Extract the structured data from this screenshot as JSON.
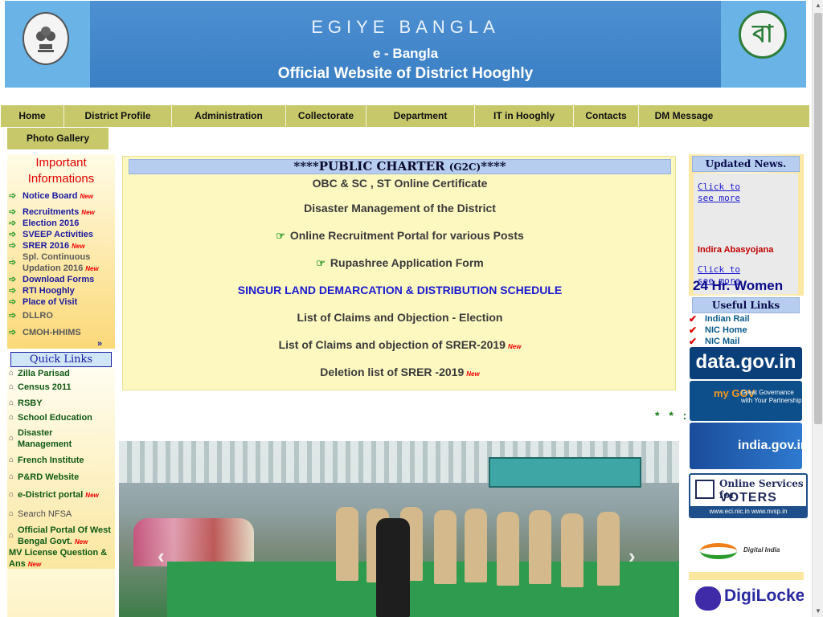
{
  "header": {
    "title_line1": "EGIYE BANGLA",
    "title_line2": "e - Bangla",
    "title_line3": "Official Website of District Hooghly",
    "right_logo_glyph": "বা"
  },
  "nav": {
    "items": [
      "Home",
      "District Profile",
      "Administration",
      "Collectorate",
      "Department",
      "IT in Hooghly",
      "Contacts",
      "DM Message"
    ],
    "row2": "Photo Gallery"
  },
  "important": {
    "title_line1": "Important",
    "title_line2": "Informations",
    "new_label": "New",
    "items": [
      {
        "label": "Notice Board",
        "is_new": true
      },
      {
        "label": "Recruitments",
        "is_new": true
      },
      {
        "label": "Election 2016",
        "is_new": false
      },
      {
        "label": "SVEEP Activities",
        "is_new": false
      },
      {
        "label": "SRER 2016",
        "is_new": true
      },
      {
        "label": "Spl. Continuous Updation 2016",
        "is_new": true
      },
      {
        "label": "Download Forms",
        "is_new": false
      },
      {
        "label": "RTI Hooghly",
        "is_new": false
      },
      {
        "label": "Place of Visit",
        "is_new": false
      },
      {
        "label": "DLLRO",
        "is_new": false
      },
      {
        "label": "CMOH-HHIMS",
        "is_new": false
      }
    ]
  },
  "quick_links": {
    "title": "Quick Links",
    "items": [
      {
        "label": "Zilla Parisad"
      },
      {
        "label": "Census 2011"
      },
      {
        "label": "RSBY"
      },
      {
        "label": "School Education"
      },
      {
        "label": "Disaster Management"
      },
      {
        "label": "French Institute"
      },
      {
        "label": "P&RD Website"
      },
      {
        "label": "e-District portal",
        "is_new": true
      },
      {
        "label": "Search NFSA"
      },
      {
        "label": "Official Portal Of West Bengal Govt.",
        "is_new": true
      },
      {
        "label": "MV License Question & Ans",
        "is_new": true
      }
    ]
  },
  "charter": {
    "title": "****PUBLIC CHARTER",
    "title_suffix": "(G2C)",
    "title_end": "****",
    "links": [
      "OBC & SC , ST Online Certificate",
      "Disaster Management of the District",
      "Online Recruitment Portal for various Posts",
      "Rupashree Application Form",
      "SINGUR LAND DEMARCATION & DISTRIBUTION SCHEDULE",
      "List of Claims and Objection - Election",
      "List of Claims and objection of SRER-2019",
      "Deletion list of SRER -2019"
    ],
    "new_label": "New",
    "marquee": "* * :"
  },
  "slideshow": {
    "prev": "‹",
    "next": "›"
  },
  "updated_news": {
    "title": "Updated News.",
    "click_more": "Click to see more",
    "item": "Indira Abasyojana",
    "headline": "24 Hr. Women"
  },
  "useful_links": {
    "title": "Useful Links",
    "items": [
      "Indian Rail",
      "NIC Home",
      "NIC Mail"
    ]
  },
  "right_banners": {
    "datagov": "data.gov.in",
    "mygov_brand": "my GOV",
    "mygov_tag": "Great Governance with Your Partnership",
    "indiagov": "india.gov.in",
    "voters_top": "Online Services for",
    "voters_main": "VOTERS",
    "voters_urls": "www.eci.nic.in  www.nvsp.in",
    "digital_india": "Digital India",
    "digilocker": "DigiLocker"
  },
  "colors": {
    "nav_bg": "#c6c86a",
    "banner_blue": "#4a90d0",
    "important_red": "#e00000",
    "link_blue": "#1a1aa0",
    "quick_green": "#0f5a14"
  }
}
